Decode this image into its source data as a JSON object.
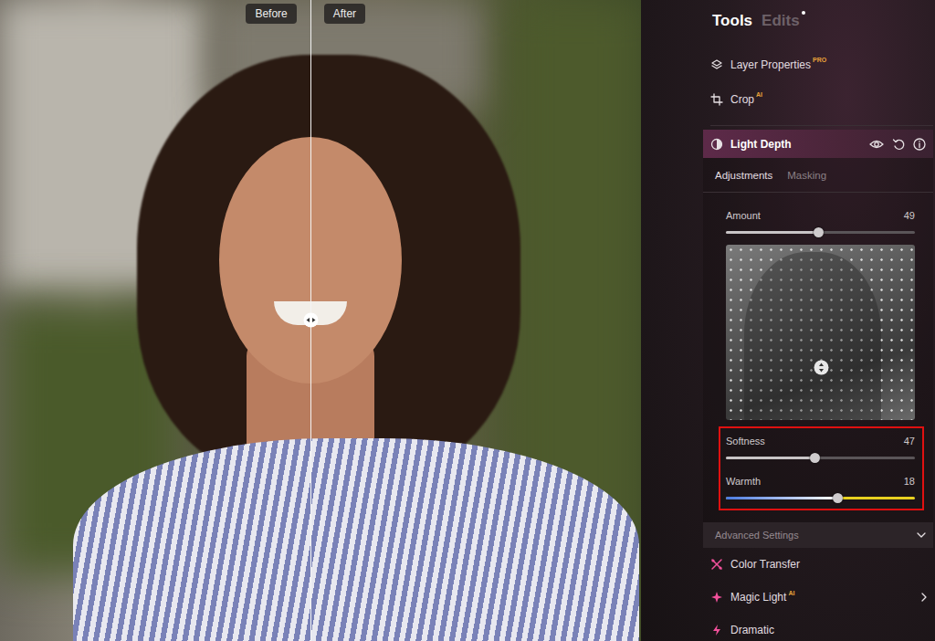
{
  "comparison": {
    "before_label": "Before",
    "after_label": "After",
    "split_level": 0.484
  },
  "panel": {
    "tabs": [
      {
        "label": "Tools",
        "selected": true,
        "has_dot": false
      },
      {
        "label": "Edits",
        "selected": false,
        "has_dot": true
      }
    ],
    "tools_top": [
      {
        "label": "Layer Properties",
        "badge": "PRO"
      },
      {
        "label": "Crop",
        "badge": "AI"
      }
    ],
    "active_tool": {
      "title": "Light Depth",
      "expanded": true,
      "subtabs": [
        {
          "label": "Adjustments",
          "selected": true
        },
        {
          "label": "Masking",
          "selected": false
        }
      ],
      "amount": {
        "label": "Amount",
        "reading": "49",
        "level": 0.49,
        "kind": "plain"
      },
      "depth_map": {
        "handle_x": 0.5,
        "handle_y": 0.7
      },
      "highlight": {
        "highlighted": true,
        "sliders": [
          {
            "label": "Softness",
            "reading": "47",
            "level": 0.47,
            "kind": "plain"
          },
          {
            "label": "Warmth",
            "reading": "18",
            "level": 0.59,
            "kind": "warmth"
          }
        ]
      },
      "advanced": {
        "label": "Advanced Settings",
        "expanded": false
      }
    },
    "tools_bottom": [
      {
        "label": "Color Transfer",
        "has_submenu": false
      },
      {
        "label": "Magic Light",
        "badge": "AI",
        "has_submenu": true
      },
      {
        "label": "Dramatic",
        "has_submenu": false
      }
    ]
  }
}
